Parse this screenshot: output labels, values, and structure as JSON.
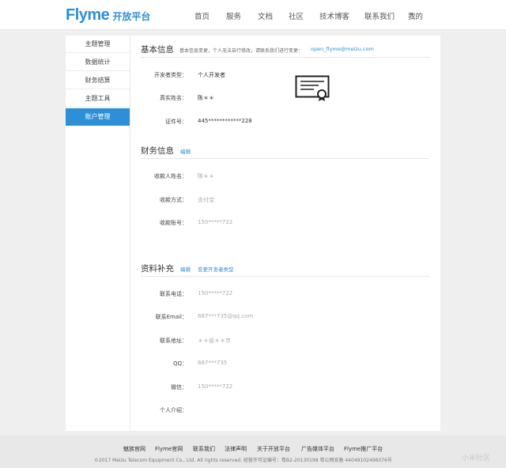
{
  "header": {
    "logo_text": "Flyme",
    "logo_sub": "开放平台",
    "nav": [
      "首页",
      "服务",
      "文档",
      "社区",
      "技术博客",
      "联系我们",
      "我的"
    ]
  },
  "sidebar": {
    "items": [
      "主题管理",
      "数据统计",
      "财务结算",
      "主题工具",
      "账户管理"
    ],
    "active": "账户管理"
  },
  "basic": {
    "title": "基本信息",
    "note": "基本信息变更，个人无法自行修改，请联系我们进行变更：",
    "email": "open_flyme@meizu.com",
    "fields": [
      {
        "label": "开发者类型：",
        "value": "个人开发者"
      },
      {
        "label": "真实姓名：",
        "value": "陈＊＊"
      },
      {
        "label": "证件号：",
        "value": "445************228"
      }
    ]
  },
  "finance": {
    "title": "财务信息",
    "edit": "编辑",
    "fields": [
      {
        "label": "收款人姓名：",
        "value": "陈＊＊"
      },
      {
        "label": "收款方式：",
        "value": "支付宝"
      },
      {
        "label": "收款账号：",
        "value": "150*****722"
      }
    ]
  },
  "supplement": {
    "title": "资料补充",
    "edit": "编辑",
    "change_type": "变更开发者类型",
    "fields": [
      {
        "label": "联系电话：",
        "value": "150*****722"
      },
      {
        "label": "联系Email：",
        "value": "667***735@qq.com"
      },
      {
        "label": "联系地址：",
        "value": "＊＊省＊＊市"
      },
      {
        "label": "QQ：",
        "value": "667***735"
      },
      {
        "label": "微信：",
        "value": "150*****722"
      },
      {
        "label": "个人介绍：",
        "value": ""
      }
    ]
  },
  "footer": {
    "links": [
      "魅族官网",
      "Flyme官网",
      "联系我们",
      "法律声明",
      "关于开放平台",
      "广告媒体平台",
      "Flyme推广平台"
    ],
    "copyright": "©2017 Meizu Telecom Equipment Co., Ltd. All rights reserved. 经营许可证编号：粤B2-20130198 粤公网安备 44049102496076号"
  },
  "watermark": "小米社区",
  "icons": {
    "certificate": "certificate-icon",
    "dropdown": "chevron-down-icon"
  },
  "colors": {
    "accent": "#2d8fd6"
  }
}
